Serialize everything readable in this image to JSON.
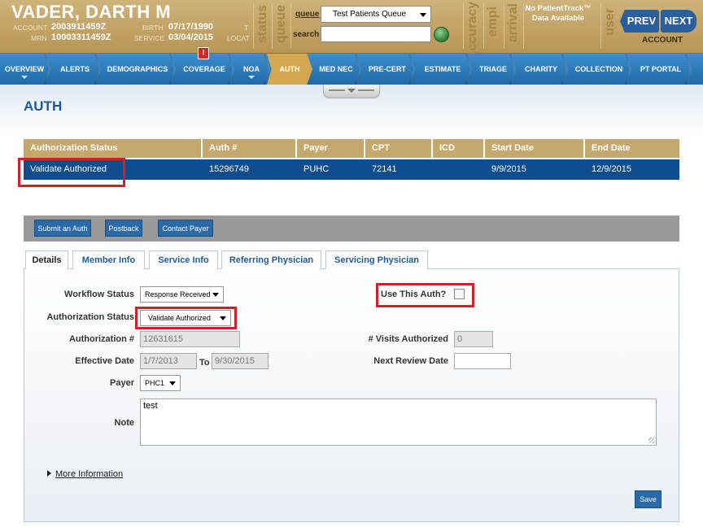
{
  "header": {
    "patient_name": "VADER, DARTH M",
    "account_label": "ACCOUNT",
    "account_value": "2003911459Z",
    "mrn_label": "MRN",
    "mrn_value": "10003311459Z",
    "birth_label": "BIRTH",
    "birth_value": "07/17/1990",
    "service_label": "SERVICE",
    "service_value": "03/04/2015",
    "t_label": "T",
    "locat_label": "LOCAT",
    "vertical_labels": [
      "status",
      "queue",
      "accuracy",
      "empi",
      "arrival",
      "user"
    ],
    "queue_label": "queue",
    "queue_value": "Test Patients Queue",
    "search_label": "search",
    "no_patienttrack": "No PatientTrack™ Data Available",
    "prev_label": "PREV",
    "next_label": "NEXT",
    "account_nav_label": "ACCOUNT"
  },
  "nav": {
    "items": [
      "OVERVIEW",
      "ALERTS",
      "DEMOGRAPHICS",
      "COVERAGE",
      "NOA",
      "AUTH",
      "MED NEC",
      "PRE-CERT",
      "ESTIMATE",
      "TRIAGE",
      "CHARITY",
      "COLLECTION",
      "PT PORTAL"
    ],
    "active": "AUTH",
    "alert_badge": "!"
  },
  "page": {
    "title": "AUTH"
  },
  "auth_table": {
    "headers": [
      "Authorization Status",
      "Auth #",
      "Payer",
      "CPT",
      "ICD",
      "Start Date",
      "End Date"
    ],
    "rows": [
      [
        "Validate Authorized",
        "15296749",
        "PUHC",
        "72141",
        "",
        "9/9/2015",
        "12/9/2015"
      ]
    ]
  },
  "toolbar": {
    "submit_label": "Submit an Auth",
    "postback_label": "Postback",
    "contact_label": "Contact Payer"
  },
  "tabs": [
    "Details",
    "Member Info",
    "Service Info",
    "Referring Physician",
    "Servicing Physician"
  ],
  "form": {
    "workflow_status_label": "Workflow Status",
    "workflow_status_value": "Response Received",
    "auth_status_label": "Authorization Status",
    "auth_status_value": "Validate Authorized",
    "auth_number_label": "Authorization #",
    "auth_number_value": "12631615",
    "effective_date_label": "Effective Date",
    "effective_from": "1/7/2013",
    "to_label": "To",
    "effective_to": "9/30/2015",
    "payer_label": "Payer",
    "payer_value": "PHC1",
    "note_label": "Note",
    "note_value": "test",
    "use_auth_label": "Use This Auth?",
    "visits_label": "# Visits Authorized",
    "visits_value": "0",
    "next_review_label": "Next Review Date",
    "more_info_label": "More Information",
    "save_label": "Save"
  }
}
